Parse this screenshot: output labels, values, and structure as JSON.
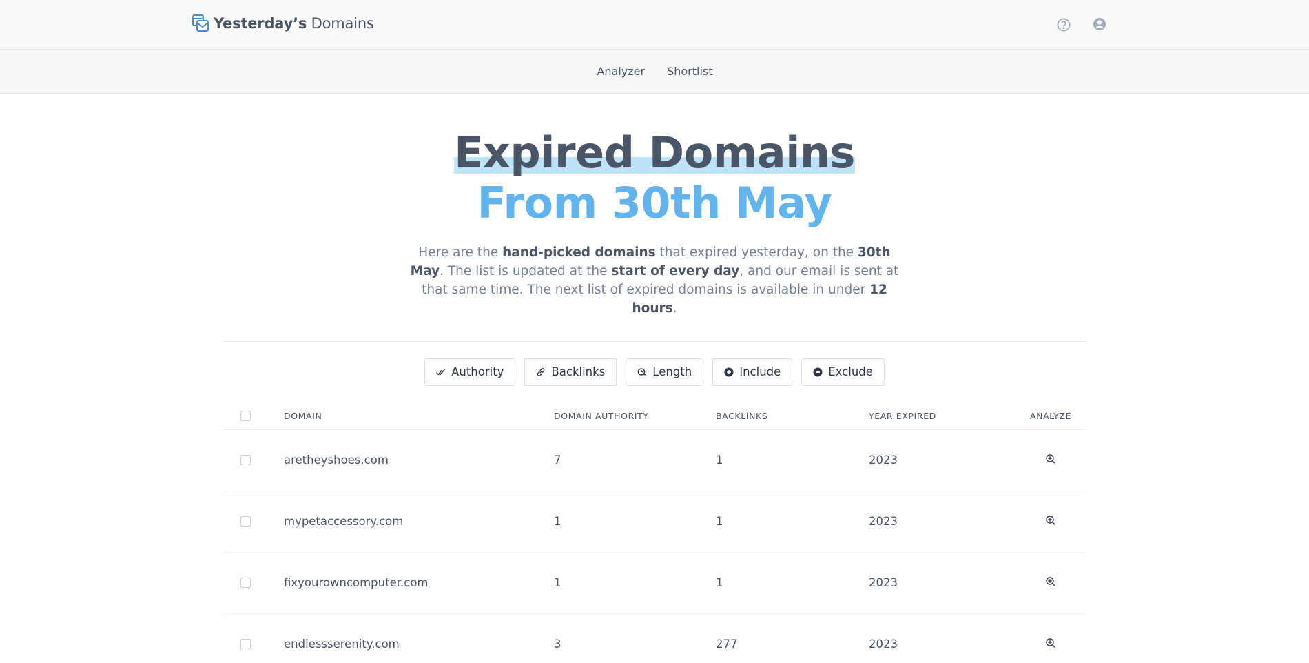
{
  "header": {
    "brand_bold": "Yesterday’s",
    "brand_rest": "Domains",
    "icons": [
      "mail-logo-icon",
      "help-icon",
      "user-icon"
    ]
  },
  "subnav": {
    "items": [
      {
        "label": "Analyzer"
      },
      {
        "label": "Shortlist"
      }
    ]
  },
  "hero": {
    "title": "Expired Domains",
    "subtitle": "From 30th May",
    "intro": {
      "p1": "Here are the ",
      "b1": "hand-picked domains",
      "p2": " that expired yesterday, on the ",
      "b2": "30th May",
      "p3": ". The list is updated at the ",
      "b3": "start of every day",
      "p4": ", and our email is sent at that same time. The next list of expired domains is available in under ",
      "b4": "12 hours",
      "p5": "."
    }
  },
  "filters": [
    {
      "label": "Authority",
      "icon": "double-check-icon"
    },
    {
      "label": "Backlinks",
      "icon": "link-icon"
    },
    {
      "label": "Length",
      "icon": "length-icon"
    },
    {
      "label": "Include",
      "icon": "plus-circle-icon"
    },
    {
      "label": "Exclude",
      "icon": "minus-circle-icon"
    }
  ],
  "table": {
    "columns": {
      "domain": "DOMAIN",
      "authority": "DOMAIN AUTHORITY",
      "backlinks": "BACKLINKS",
      "year": "YEAR EXPIRED",
      "analyze": "ANALYZE"
    },
    "rows": [
      {
        "domain": "aretheyshoes.com",
        "authority": "7",
        "backlinks": "1",
        "year": "2023"
      },
      {
        "domain": "mypetaccessory.com",
        "authority": "1",
        "backlinks": "1",
        "year": "2023"
      },
      {
        "domain": "fixyourowncomputer.com",
        "authority": "1",
        "backlinks": "1",
        "year": "2023"
      },
      {
        "domain": "endlessserenity.com",
        "authority": "3",
        "backlinks": "277",
        "year": "2023"
      }
    ]
  },
  "colors": {
    "accent_blue": "#63b3ed",
    "highlight": "#bee3f8",
    "text_dark": "#4a5568"
  }
}
